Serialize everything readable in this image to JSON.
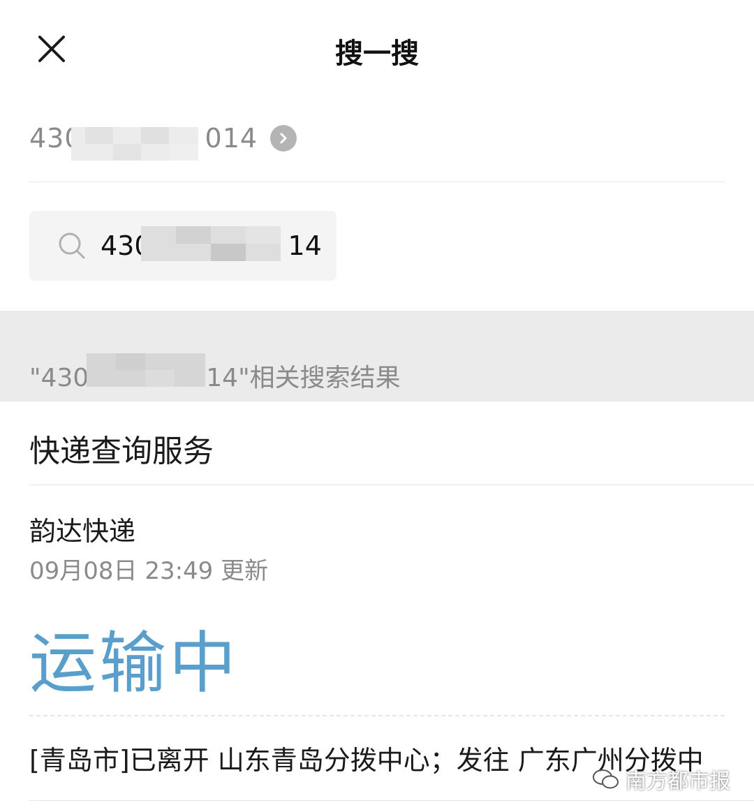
{
  "header": {
    "title": "搜一搜",
    "close_icon": "close-icon"
  },
  "query": {
    "text": "430            014",
    "prefix": "430",
    "suffix": "014",
    "chevron_icon": "chevron-right-icon"
  },
  "search": {
    "value_prefix": "430",
    "value_suffix": "14",
    "icon": "search-icon"
  },
  "results": {
    "label_prefix": "\"430",
    "label_suffix": "14\"相关搜索结果"
  },
  "service": {
    "title": "快递查询服务"
  },
  "parcel": {
    "courier": "韵达快递",
    "updated": "09月08日 23:49 更新",
    "status": "运输中",
    "latest_event": "[青岛市]已离开 山东青岛分拨中心；发往 广东广州分拨中"
  },
  "watermark": {
    "text": "南方都市报"
  },
  "colors": {
    "status": "#5a9ecb",
    "band": "#ebebeb",
    "muted": "#8a8a8a"
  }
}
